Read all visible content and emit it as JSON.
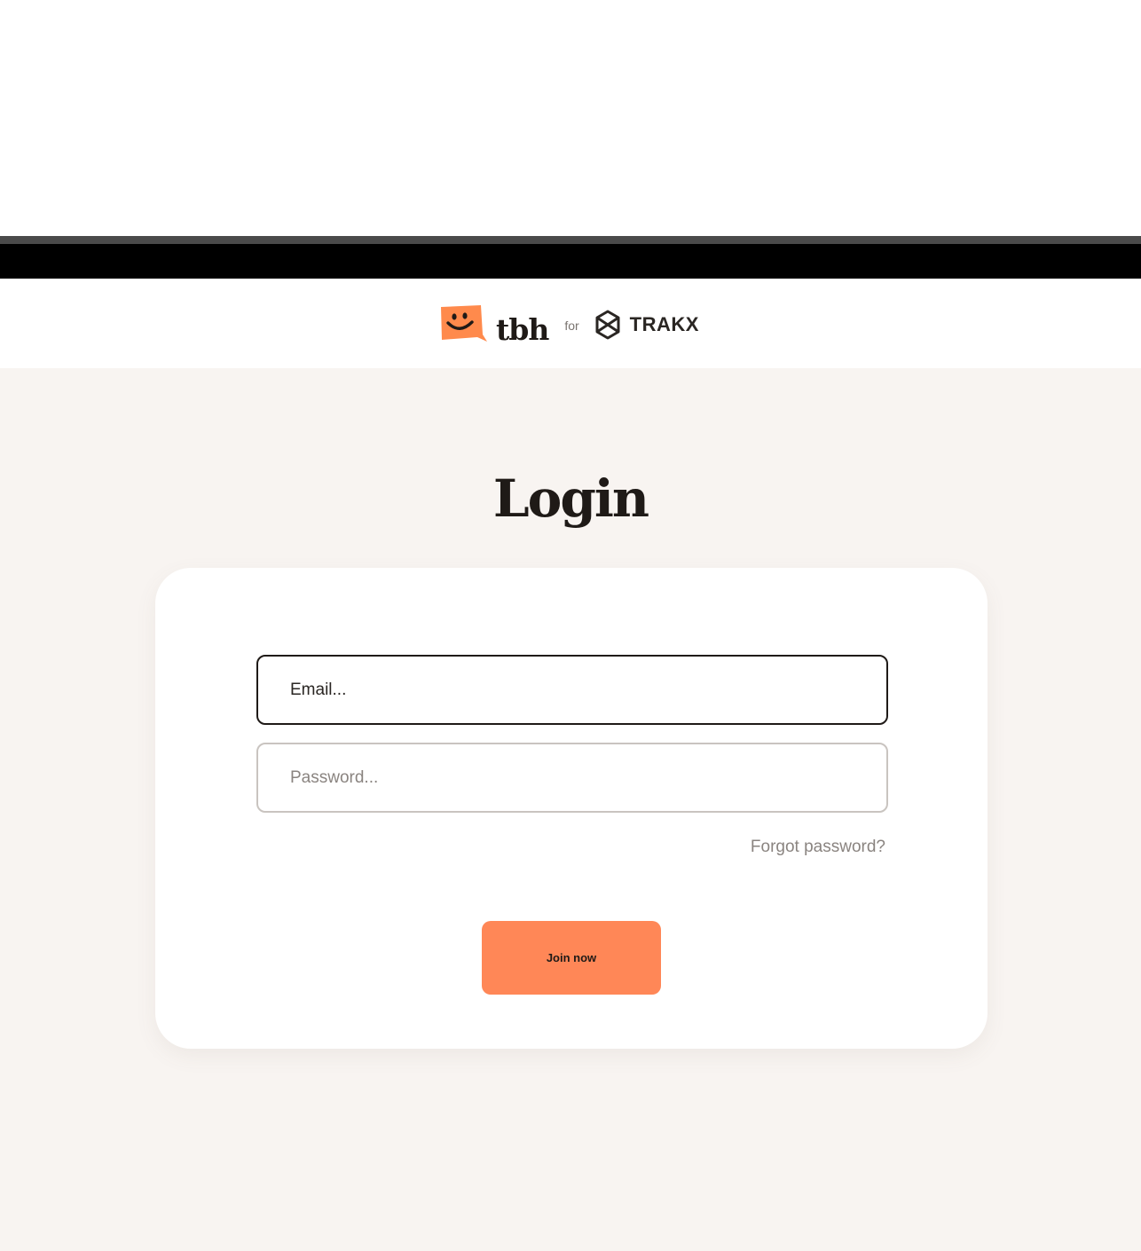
{
  "header": {
    "brand_name": "tbh",
    "connector": "for",
    "partner_name": "TRAKX"
  },
  "login": {
    "title": "Login",
    "email": {
      "value": "",
      "placeholder": "Email..."
    },
    "password": {
      "value": "",
      "placeholder": "Password..."
    },
    "forgot_label": "Forgot password?",
    "submit_label": "Join now"
  },
  "colors": {
    "accent": "#ff8757",
    "logo_orange": "#ff8a4c",
    "page_background": "#f8f4f1",
    "text_dark": "#1f1a17",
    "muted_text": "#8a8480"
  },
  "icons": {
    "brand_logo": "smiley-speech-bubble-icon",
    "partner_logo": "trakx-hexagon-icon"
  }
}
